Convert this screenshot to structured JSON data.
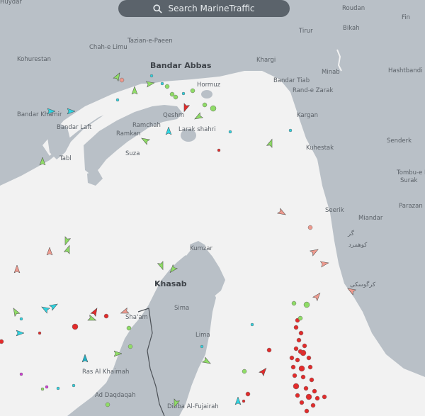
{
  "search": {
    "placeholder": "Search MarineTraffic",
    "icon": "search-icon"
  },
  "colors": {
    "sea": "#f2f2f2",
    "land": "#b9c0c7",
    "cargo_vessel": "#8fdc66",
    "tanker_vessel": "#e32b2b",
    "passenger_vessel": "#2fd3e0",
    "tug_vessel": "#22b0c4",
    "pleasure_vessel": "#d23bd8",
    "unknown_vessel": "#ee9a8e"
  },
  "places": [
    {
      "id": "huydar",
      "name": "Huydar"
    },
    {
      "id": "roudan",
      "name": "Roudan"
    },
    {
      "id": "fin",
      "name": "Fin"
    },
    {
      "id": "tirur",
      "name": "Tirur"
    },
    {
      "id": "bikah",
      "name": "Bikah"
    },
    {
      "id": "tazian",
      "name": "Tazian-e-Paeen"
    },
    {
      "id": "chahe",
      "name": "Chah-e Limu"
    },
    {
      "id": "kohurestan",
      "name": "Kohurestan"
    },
    {
      "id": "bandar-abbas",
      "name": "Bandar Abbas"
    },
    {
      "id": "khargi",
      "name": "Khargi"
    },
    {
      "id": "minab",
      "name": "Minab"
    },
    {
      "id": "hashtbandi",
      "name": "Hashtbandi"
    },
    {
      "id": "hormuz",
      "name": "Hormuz"
    },
    {
      "id": "bandar-tiab",
      "name": "Bandar Tiab"
    },
    {
      "id": "rand",
      "name": "Rand-e Zarak"
    },
    {
      "id": "bandar-khamir",
      "name": "Bandar Khamir"
    },
    {
      "id": "qeshm",
      "name": "Qeshm"
    },
    {
      "id": "kargan",
      "name": "Kargan"
    },
    {
      "id": "ramchah",
      "name": "Ramchah"
    },
    {
      "id": "bandar-laft",
      "name": "Bandar Laft"
    },
    {
      "id": "larak",
      "name": "Larak shahri"
    },
    {
      "id": "ramkan",
      "name": "Ramkan"
    },
    {
      "id": "senderk",
      "name": "Senderk"
    },
    {
      "id": "kuhestak",
      "name": "Kuhestak"
    },
    {
      "id": "suza",
      "name": "Suza"
    },
    {
      "id": "tabl",
      "name": "Tabl"
    },
    {
      "id": "tombu",
      "name": "Tombu-e Be"
    },
    {
      "id": "surak",
      "name": "Surak"
    },
    {
      "id": "parazan",
      "name": "Parazan"
    },
    {
      "id": "seerik",
      "name": "Seerik"
    },
    {
      "id": "miandar",
      "name": "Miandar"
    },
    {
      "id": "gar",
      "name": "گر"
    },
    {
      "id": "kuhmbord",
      "name": "کوهمرد"
    },
    {
      "id": "kumzar",
      "name": "Kumzar"
    },
    {
      "id": "kargoski",
      "name": "کرگوسکی"
    },
    {
      "id": "khasab",
      "name": "Khasab"
    },
    {
      "id": "sima",
      "name": "Sima"
    },
    {
      "id": "shaam",
      "name": "Sha'am"
    },
    {
      "id": "lima",
      "name": "Lima"
    },
    {
      "id": "ras-al-khaimah",
      "name": "Ras Al Khaimah"
    },
    {
      "id": "ad-daqdaqah",
      "name": "Ad Daqdaqah"
    },
    {
      "id": "dibba",
      "name": "Dibba Al-Fujairah"
    }
  ]
}
